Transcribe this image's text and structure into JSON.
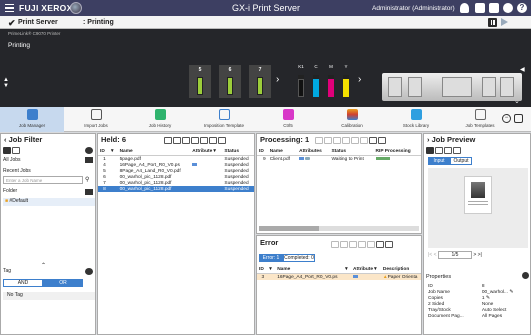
{
  "app": {
    "logo": "FUJI XEROX",
    "title": "GX-i Print Server",
    "admin": "Administrator (Administrator)"
  },
  "status": {
    "server": "Print Server",
    "sep": ":",
    "state": "Printing"
  },
  "printer": {
    "model": "PrimeLink® C9070 Printer",
    "state": "Printing",
    "trays": [
      {
        "n": "5"
      },
      {
        "n": "6"
      },
      {
        "n": "7"
      }
    ],
    "toners": [
      {
        "n": "K1",
        "color": "#111111"
      },
      {
        "n": "C",
        "color": "#00a8e0"
      },
      {
        "n": "M",
        "color": "#e0007a"
      },
      {
        "n": "Y",
        "color": "#f5e100"
      }
    ]
  },
  "toolbar": [
    {
      "label": "Job Manager",
      "color": "#3d7fcc"
    },
    {
      "label": "Import Jobs",
      "color": "#555555"
    },
    {
      "label": "Job History",
      "color": "#2fb36d"
    },
    {
      "label": "Imposition Template",
      "color": "#3d7fcc"
    },
    {
      "label": "Ctrl5",
      "color": "#d838c8"
    },
    {
      "label": "Calibration",
      "color": "#e8a020"
    },
    {
      "label": "Stock Library",
      "color": "#2f9fe0"
    },
    {
      "label": "Job Templates",
      "color": "#666666"
    }
  ],
  "filter": {
    "title": "Job Filter",
    "all": "All Jobs",
    "recent": "Recent Jobs",
    "search_ph": "Enter a Job Name",
    "folder": "Folder",
    "default": "#Default",
    "tag": "Tag",
    "and": "AND",
    "or": "OR",
    "notag": "No Tag"
  },
  "held": {
    "title": "Held: 6",
    "cols": [
      "ID",
      "Name",
      "Attribute",
      "Status"
    ],
    "rows": [
      {
        "id": "1",
        "name": "5page.pdf",
        "status": "Suspended"
      },
      {
        "id": "4",
        "name": "16Page_A4_Port_R0_V0.ps",
        "status": "Suspended"
      },
      {
        "id": "5",
        "name": "8Page_A4_Land_R0_V0.pdf",
        "status": "Suspended"
      },
      {
        "id": "6",
        "name": "00_warhol_pic_1128.pdf",
        "status": "Suspended"
      },
      {
        "id": "7",
        "name": "00_warhol_pic_1128.pdf",
        "status": "Suspended"
      },
      {
        "id": "8",
        "name": "00_warhol_pic_1128.pdf",
        "status": "Suspended"
      }
    ]
  },
  "processing": {
    "title": "Processing: 1",
    "cols": [
      "ID",
      "Name",
      "Attributes",
      "Status",
      "RIP Processing"
    ],
    "rows": [
      {
        "id": "9",
        "name": "Client.pdf",
        "status": "Waiting to Print"
      }
    ]
  },
  "error": {
    "title": "Error",
    "tab1": "Error: 1",
    "tab2": "Completed: 0",
    "cols": [
      "ID",
      "Name",
      "Attribute",
      "Description"
    ],
    "rows": [
      {
        "id": "3",
        "name": "16Page_A4_Port_R0_V0.ps",
        "desc": "Paper Orienta"
      }
    ]
  },
  "preview": {
    "title": "Job Preview",
    "input": "Input",
    "output": "Output",
    "page": "1/5",
    "props_title": "Properties",
    "props": [
      {
        "k": "ID",
        "v": "8"
      },
      {
        "k": "Job Name",
        "v": "00_warhol..."
      },
      {
        "k": "Copies",
        "v": "1"
      },
      {
        "k": "2 Sided",
        "v": "None"
      },
      {
        "k": "Tray/Stock",
        "v": "Auto Select"
      },
      {
        "k": "Document Pag...",
        "v": "All Pages"
      }
    ]
  }
}
